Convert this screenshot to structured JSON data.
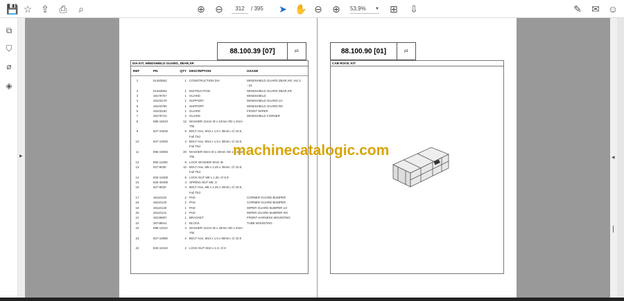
{
  "toolbar": {
    "current_page": "312",
    "total_pages": "/ 395",
    "zoom": "53,9%",
    "icons": [
      "save-icon",
      "star-icon",
      "upload-icon",
      "print-icon",
      "search-icon",
      "page-up-icon",
      "page-down-icon",
      "select-cursor-icon",
      "hand-icon",
      "zoom-out-icon",
      "zoom-in-icon",
      "fit-page-icon",
      "scroll-mode-icon",
      "sign-icon",
      "mail-icon",
      "add-user-icon"
    ]
  },
  "watermark": "machinecatalogic.com",
  "page1": {
    "code": "88.100.39 [07]",
    "page_label": "p1",
    "title": "DIA KIT, WINDSHIELD GUARD, ZBAR,XR",
    "headers": [
      "REF",
      "PN",
      "QTY",
      "DESCRIPTION",
      "USAGE"
    ],
    "rows": [
      [
        "1",
        "51453562",
        "1",
        "CONSTRUCTION DIA",
        "WINDSHIELD GUARD ZBAR,XR, Incl 2 - 24"
      ],
      [
        "2",
        "51453563",
        "1",
        "INSTRUCTION",
        "WINDSHIELD GUARD ZBAR,XR"
      ],
      [
        "3",
        "48179757",
        "1",
        "GUARD",
        "WINDSHIELD"
      ],
      [
        "4",
        "48103179",
        "1",
        "SUPPORT",
        "WINDSHIELD GUARD LH"
      ],
      [
        "5",
        "48103790",
        "1",
        "SUPPORT",
        "WINDSHIELD GUARD RH"
      ],
      [
        "6",
        "48103183",
        "1",
        "GUARD",
        "FRONT WIPER"
      ],
      [
        "7",
        "48179710",
        "2",
        "GUARD",
        "WINDSHIELD CORNER"
      ],
      [
        "8",
        "895-15010",
        "12",
        "WASHER 11mm ID x 24mm OD x 2mm Thk",
        ""
      ],
      [
        "9",
        "827-10036",
        "8",
        "BOLT Hex, M10 x 1.5 x 35mm, Cl 10.9, Full Thd",
        ""
      ],
      [
        "10",
        "827-10030",
        "4",
        "BOLT Hex, M10 x 1.5 x 30mm, Cl 10.9, Full Thd",
        ""
      ],
      [
        "11",
        "895-15006",
        "20",
        "WASHER 9mm ID x 20mm OD x 1.6mm Thk",
        ""
      ],
      [
        "12",
        "892-11006",
        "8",
        "LOCK WASHER 8mm ID",
        ""
      ],
      [
        "13",
        "827-8030",
        "10",
        "BOLT Hex, M8 x 1.25 x 30mm, Cl 10.9, Full Thd",
        ""
      ],
      [
        "14",
        "832-10408",
        "6",
        "LOCK NUT M8 x 1.25, Cl 8.8",
        ""
      ],
      [
        "15",
        "833-40408",
        "4",
        "SPRING NUT M8, U",
        ""
      ],
      [
        "16",
        "827-8020",
        "4",
        "BOLT Hex, M8 x 1.25 x 20mm, Cl 10.9, Full Thd",
        ""
      ],
      [
        "17",
        "48110132",
        "2",
        "PAD",
        "CORNER GUARD BUMPER"
      ],
      [
        "18",
        "48110133",
        "2",
        "PAD",
        "CORNER GUARD BUMPER"
      ],
      [
        "19",
        "48110140",
        "1",
        "PAD",
        "WIPER GUARD BUMPER LH"
      ],
      [
        "20",
        "48110141",
        "1",
        "PAD",
        "WIPER GUARD BUMPER RH"
      ],
      [
        "21",
        "48136807",
        "1",
        "BRACKET",
        "FRONT HARNESS MOUNTING"
      ],
      [
        "22",
        "36748541",
        "1",
        "BLOCK",
        "TUBE MOUNTING"
      ],
      [
        "22",
        "895-11010",
        "4",
        "WASHER 11mm ID x 20mm OD x 2mm Thk",
        ""
      ],
      [
        "23",
        "827-10080",
        "2",
        "BOLT Hex, M10 x 1.5 x 80mm, Cl 10.9",
        ""
      ],
      [
        "24",
        "832-10410",
        "2",
        "LOCK NUT M10 x 1.5, Cl 8",
        ""
      ]
    ]
  },
  "page2": {
    "code": "88.100.90 [01]",
    "page_label": "p1",
    "title": "CAB ROOF, KIT"
  }
}
